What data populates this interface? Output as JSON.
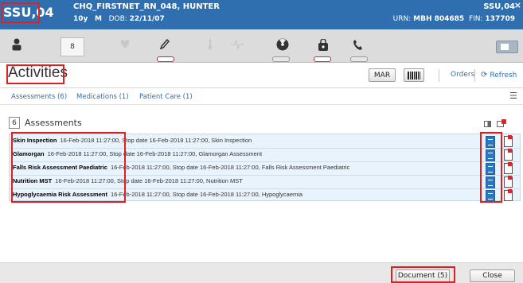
{
  "header": {
    "ward": "SSU,04",
    "patient_name": "CHQ_FIRSTNET_RN_048, HUNTER",
    "age": "10y",
    "sex": "M",
    "dob_label": "DOB:",
    "dob": "22/11/07",
    "right_ward": "SSU,04",
    "urn_label": "URN:",
    "urn": "MBH 804685",
    "fin_label": "FIN:",
    "fin": "137709",
    "close_glyph": "×"
  },
  "toolbar": {
    "tab_label": "8",
    "icons": [
      "person-icon",
      "heart-icon",
      "pen-icon",
      "thermometer-icon",
      "pulse-icon",
      "radiation-icon",
      "lock-icon",
      "phone-icon"
    ]
  },
  "activities": {
    "title": "Activities",
    "mar_label": "MAR",
    "orders_label": "Orders",
    "refresh_label": "Refresh"
  },
  "tabs": [
    {
      "label": "Assessments (6)"
    },
    {
      "label": "Medications (1)"
    },
    {
      "label": "Patient Care (1)"
    }
  ],
  "assessments": {
    "count": "6",
    "title": "Assessments",
    "rows": [
      {
        "name": "Skin Inspection",
        "detail": "16-Feb-2018 11:27:00, Stop date 16-Feb-2018 11:27:00, Skin Inspection"
      },
      {
        "name": "Glamorgan",
        "detail": "16-Feb-2018 11:27:00, Stop date 16-Feb-2018 11:27:00, Glamorgan Assessment"
      },
      {
        "name": "Falls Risk Assessment Paediatric",
        "detail": "16-Feb-2018 11:27:00, Stop date 16-Feb-2018 11:27:00, Falls Risk Assessment Paediatric"
      },
      {
        "name": "Nutrition MST",
        "detail": "16-Feb-2018 11:27:00, Stop date 16-Feb-2018 11:27:00, Nutrition MST"
      },
      {
        "name": "Hypoglycaemia Risk Assessment",
        "detail": "16-Feb-2018 11:27:00, Stop date 16-Feb-2018 11:27:00, Hypoglycaemia"
      }
    ]
  },
  "footer": {
    "document_label": "Document (5)",
    "close_label": "Close"
  },
  "colors": {
    "header_blue": "#2f6fb0",
    "link_blue": "#2f6fb0",
    "highlight_red": "#e02020",
    "row_bg": "#e9f3fb"
  }
}
